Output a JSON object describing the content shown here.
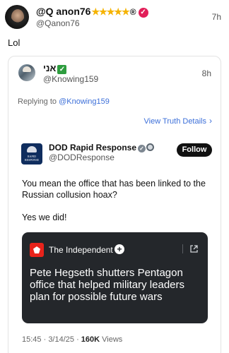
{
  "post": {
    "display_name": "@Q anon76",
    "stars": "★★★★★",
    "registered_mark": "®",
    "handle": "@Qanon76",
    "time": "7h",
    "text": "Lol"
  },
  "quoted": {
    "display_name": "אני",
    "handle": "@Knowing159",
    "time": "8h",
    "replying_prefix": "Replying to",
    "replying_mention": "@Knowing159",
    "view_details": "View Truth Details",
    "embed": {
      "account_name": "DOD Rapid Response",
      "handle": "@DODResponse",
      "follow_label": "Follow",
      "logo_text_line1": "RAPID",
      "logo_text_line2": "RESPONSE",
      "text_1": "You mean the office that has been linked to the Russian collusion hoax?",
      "text_2": "Yes we did!",
      "link_card": {
        "source": "The Independent",
        "headline": "Pete Hegseth shutters Pentagon office that helped military leaders plan for possible future wars"
      },
      "meta_time": "15:45",
      "meta_date": "3/14/25",
      "meta_views_count": "160K",
      "meta_views_label": "Views"
    }
  },
  "colors": {
    "link": "#3c6fd9",
    "card_bg": "#24272b",
    "verified_pink": "#e21f59",
    "star": "#f5b301"
  }
}
